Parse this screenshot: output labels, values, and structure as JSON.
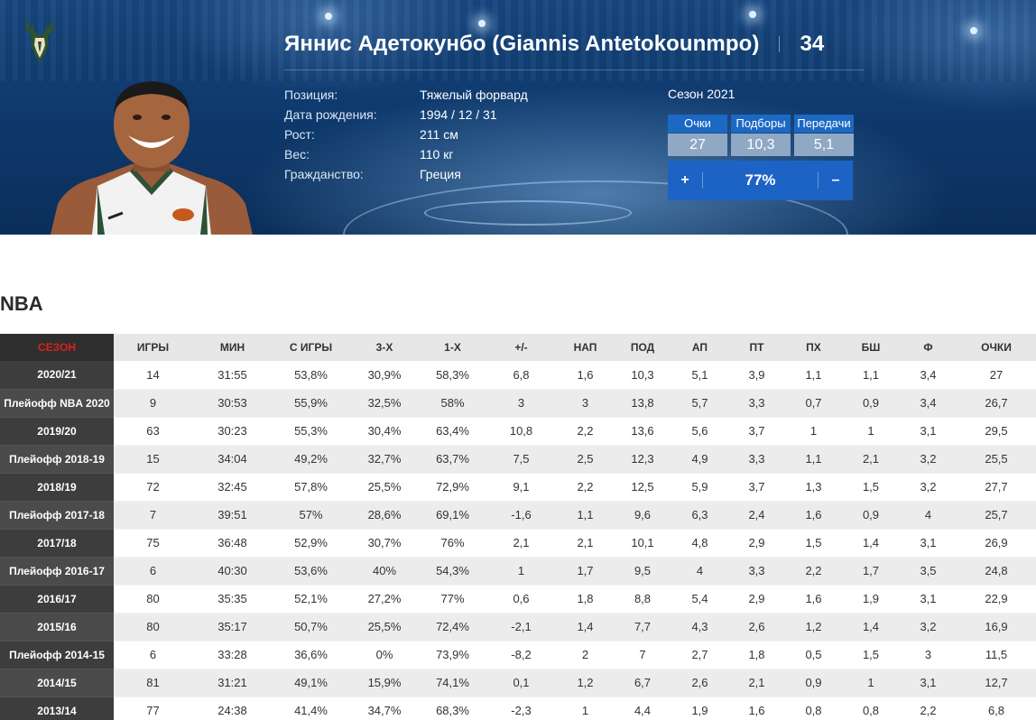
{
  "player": {
    "name": "Яннис Адетокунбо (Giannis Antetokounmpo)",
    "number": "34",
    "info": [
      {
        "label": "Позиция:",
        "value": "Тяжелый форвард"
      },
      {
        "label": "Дата рождения:",
        "value": "1994 / 12 / 31"
      },
      {
        "label": "Рост:",
        "value": "211 см"
      },
      {
        "label": "Вес:",
        "value": "110 кг"
      },
      {
        "label": "Гражданство:",
        "value": "Греция"
      }
    ]
  },
  "season": {
    "title": "Сезон 2021",
    "stats": [
      {
        "label": "Очки",
        "value": "27"
      },
      {
        "label": "Подборы",
        "value": "10,3"
      },
      {
        "label": "Передачи",
        "value": "5,1"
      }
    ],
    "rating": {
      "plus": "+",
      "value": "77%",
      "minus": "–"
    }
  },
  "team_logo_icon": "bucks-deer-logo-icon",
  "colors": {
    "accent_blue": "#1d63c6",
    "season_header_red": "#e01f1f",
    "hero_bg": "#0f3a6e"
  },
  "league": "NBA",
  "table": {
    "headers": [
      "СЕЗОН",
      "ИГРЫ",
      "МИН",
      "С ИГРЫ",
      "3-Х",
      "1-Х",
      "+/-",
      "НАП",
      "ПОД",
      "АП",
      "ПТ",
      "ПХ",
      "БШ",
      "Ф",
      "ОЧКИ"
    ],
    "rows": [
      [
        "2020/21",
        "14",
        "31:55",
        "53,8%",
        "30,9%",
        "58,3%",
        "6,8",
        "1,6",
        "10,3",
        "5,1",
        "3,9",
        "1,1",
        "1,1",
        "3,4",
        "27"
      ],
      [
        "Плейофф NBA 2020",
        "9",
        "30:53",
        "55,9%",
        "32,5%",
        "58%",
        "3",
        "3",
        "13,8",
        "5,7",
        "3,3",
        "0,7",
        "0,9",
        "3,4",
        "26,7"
      ],
      [
        "2019/20",
        "63",
        "30:23",
        "55,3%",
        "30,4%",
        "63,4%",
        "10,8",
        "2,2",
        "13,6",
        "5,6",
        "3,7",
        "1",
        "1",
        "3,1",
        "29,5"
      ],
      [
        "Плейофф 2018-19",
        "15",
        "34:04",
        "49,2%",
        "32,7%",
        "63,7%",
        "7,5",
        "2,5",
        "12,3",
        "4,9",
        "3,3",
        "1,1",
        "2,1",
        "3,2",
        "25,5"
      ],
      [
        "2018/19",
        "72",
        "32:45",
        "57,8%",
        "25,5%",
        "72,9%",
        "9,1",
        "2,2",
        "12,5",
        "5,9",
        "3,7",
        "1,3",
        "1,5",
        "3,2",
        "27,7"
      ],
      [
        "Плейофф 2017-18",
        "7",
        "39:51",
        "57%",
        "28,6%",
        "69,1%",
        "-1,6",
        "1,1",
        "9,6",
        "6,3",
        "2,4",
        "1,6",
        "0,9",
        "4",
        "25,7"
      ],
      [
        "2017/18",
        "75",
        "36:48",
        "52,9%",
        "30,7%",
        "76%",
        "2,1",
        "2,1",
        "10,1",
        "4,8",
        "2,9",
        "1,5",
        "1,4",
        "3,1",
        "26,9"
      ],
      [
        "Плейофф 2016-17",
        "6",
        "40:30",
        "53,6%",
        "40%",
        "54,3%",
        "1",
        "1,7",
        "9,5",
        "4",
        "3,3",
        "2,2",
        "1,7",
        "3,5",
        "24,8"
      ],
      [
        "2016/17",
        "80",
        "35:35",
        "52,1%",
        "27,2%",
        "77%",
        "0,6",
        "1,8",
        "8,8",
        "5,4",
        "2,9",
        "1,6",
        "1,9",
        "3,1",
        "22,9"
      ],
      [
        "2015/16",
        "80",
        "35:17",
        "50,7%",
        "25,5%",
        "72,4%",
        "-2,1",
        "1,4",
        "7,7",
        "4,3",
        "2,6",
        "1,2",
        "1,4",
        "3,2",
        "16,9"
      ],
      [
        "Плейофф 2014-15",
        "6",
        "33:28",
        "36,6%",
        "0%",
        "73,9%",
        "-8,2",
        "2",
        "7",
        "2,7",
        "1,8",
        "0,5",
        "1,5",
        "3",
        "11,5"
      ],
      [
        "2014/15",
        "81",
        "31:21",
        "49,1%",
        "15,9%",
        "74,1%",
        "0,1",
        "1,2",
        "6,7",
        "2,6",
        "2,1",
        "0,9",
        "1",
        "3,1",
        "12,7"
      ],
      [
        "2013/14",
        "77",
        "24:38",
        "41,4%",
        "34,7%",
        "68,3%",
        "-2,3",
        "1",
        "4,4",
        "1,9",
        "1,6",
        "0,8",
        "0,8",
        "2,2",
        "6,8"
      ]
    ]
  }
}
